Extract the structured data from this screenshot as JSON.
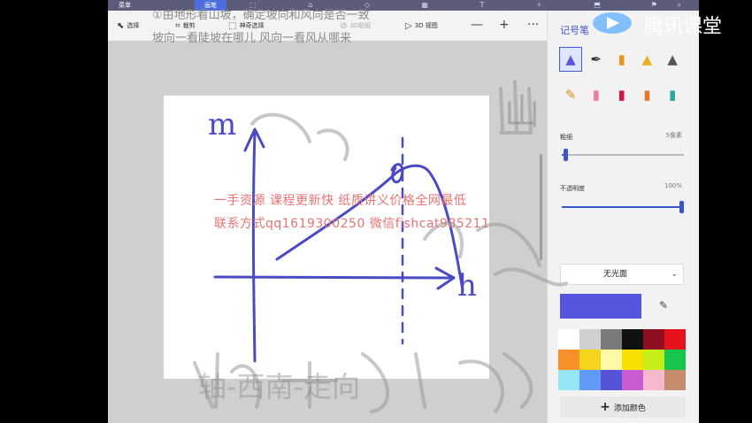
{
  "topbar": {
    "menu": "菜单",
    "active_tab": "画笔"
  },
  "toolbar": {
    "select": "选择",
    "crop": "裁剪",
    "magic_select": "神奇选择",
    "sticker": "3D贴纸",
    "view3d": "3D 视图",
    "zoom_out": "—",
    "zoom_in": "+",
    "more": "···"
  },
  "panel": {
    "title": "记号笔",
    "thickness_label": "粗细",
    "thickness_value": "5像素",
    "thickness_level": 0.03,
    "opacity_label": "不透明度",
    "opacity_value": "100%",
    "opacity_level": 1.0,
    "texture": "无光面",
    "current_color": "#5555e0",
    "add_color_label": "添加颜色",
    "brushes": [
      {
        "name": "marker-icon",
        "selected": true
      },
      {
        "name": "calligraphy-pen-icon"
      },
      {
        "name": "oil-brush-icon"
      },
      {
        "name": "watercolor-brush-icon"
      },
      {
        "name": "pixel-pen-icon"
      },
      {
        "name": "pencil-icon"
      },
      {
        "name": "eraser-icon"
      },
      {
        "name": "crayon-icon"
      },
      {
        "name": "spray-can-icon"
      },
      {
        "name": "fill-bucket-icon"
      }
    ],
    "palette": [
      "#ffffff",
      "#d0d0d0",
      "#7a7a7a",
      "#111111",
      "#8e1020",
      "#e81120",
      "#f79028",
      "#f7d41c",
      "#fff9a8",
      "#f7e000",
      "#c6ee18",
      "#16c450",
      "#94e6f4",
      "#5f9bf4",
      "#5554d8",
      "#c85cd0",
      "#f5b8cc",
      "#c48c6a"
    ]
  },
  "notes": {
    "line1": "①由地形看山坡，确定坡向和风向是否一致",
    "line2": "坡向一看陡坡在哪儿  风向一看风从哪来"
  },
  "watermark": {
    "line1": "一手资源 课程更新快 纸质讲义价格全网最低",
    "line2": "联系方式qq1619300250   微信fishcat985211"
  },
  "logo": {
    "text": "腾讯课堂"
  },
  "handwriting": {
    "y_axis": "m",
    "x_axis": "h",
    "top_right": "山",
    "bottom": "轴-西南-走向"
  }
}
